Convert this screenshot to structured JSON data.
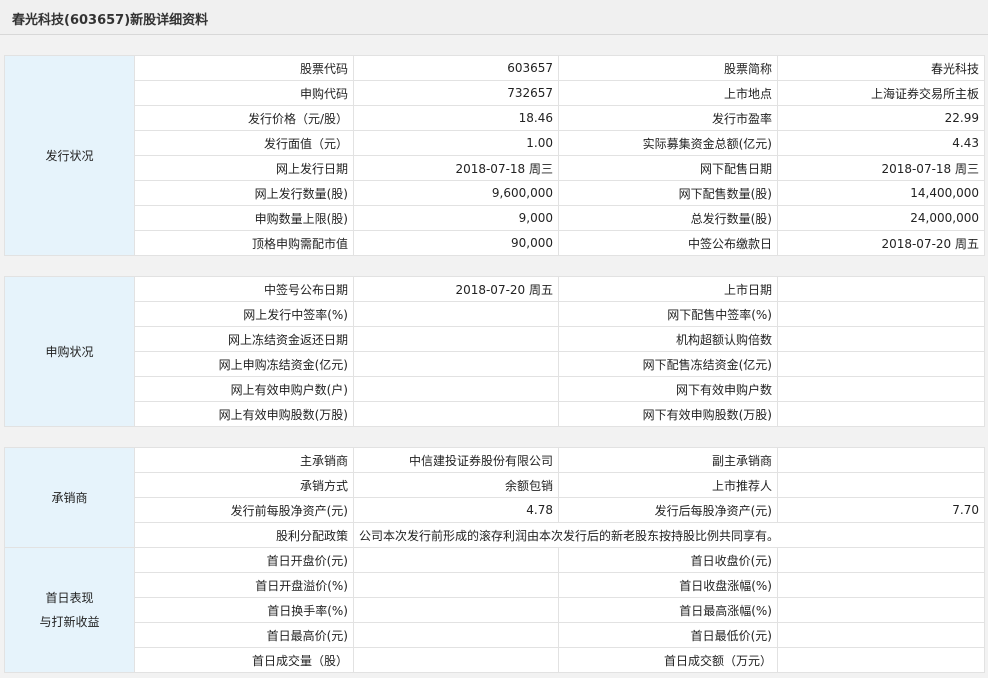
{
  "page_title": "春光科技(603657)新股详细资料",
  "sections": [
    {
      "group_lines": [
        "发行状况"
      ],
      "rows": [
        [
          "股票代码",
          "603657",
          "股票简称",
          "春光科技"
        ],
        [
          "申购代码",
          "732657",
          "上市地点",
          "上海证券交易所主板"
        ],
        [
          "发行价格（元/股）",
          "18.46",
          "发行市盈率",
          "22.99"
        ],
        [
          "发行面值（元）",
          "1.00",
          "实际募集资金总额(亿元)",
          "4.43"
        ],
        [
          "网上发行日期",
          "2018-07-18 周三",
          "网下配售日期",
          "2018-07-18 周三"
        ],
        [
          "网上发行数量(股)",
          "9,600,000",
          "网下配售数量(股)",
          "14,400,000"
        ],
        [
          "申购数量上限(股)",
          "9,000",
          "总发行数量(股)",
          "24,000,000"
        ],
        [
          "顶格申购需配市值",
          "90,000",
          "中签公布缴款日",
          "2018-07-20 周五"
        ]
      ]
    },
    {
      "group_lines": [
        "申购状况"
      ],
      "rows": [
        [
          "中签号公布日期",
          "2018-07-20 周五",
          "上市日期",
          ""
        ],
        [
          "网上发行中签率(%)",
          "",
          "网下配售中签率(%)",
          ""
        ],
        [
          "网上冻结资金返还日期",
          "",
          "机构超额认购倍数",
          ""
        ],
        [
          "网上申购冻结资金(亿元)",
          "",
          "网下配售冻结资金(亿元)",
          ""
        ],
        [
          "网上有效申购户数(户)",
          "",
          "网下有效申购户数",
          ""
        ],
        [
          "网上有效申购股数(万股)",
          "",
          "网下有效申购股数(万股)",
          ""
        ]
      ]
    },
    {
      "group_lines": [
        "承销商"
      ],
      "rows": [
        [
          "主承销商",
          "中信建投证券股份有限公司",
          "副主承销商",
          ""
        ],
        [
          "承销方式",
          "余额包销",
          "上市推荐人",
          ""
        ],
        [
          "发行前每股净资产(元)",
          "4.78",
          "发行后每股净资产(元)",
          "7.70"
        ]
      ],
      "policy": {
        "label": "股利分配政策",
        "text": "公司本次发行前形成的滚存利润由本次发行后的新老股东按持股比例共同享有。"
      }
    },
    {
      "group_lines": [
        "首日表现",
        "与打新收益"
      ],
      "rows": [
        [
          "首日开盘价(元)",
          "",
          "首日收盘价(元)",
          ""
        ],
        [
          "首日开盘溢价(%)",
          "",
          "首日收盘涨幅(%)",
          ""
        ],
        [
          "首日换手率(%)",
          "",
          "首日最高涨幅(%)",
          ""
        ],
        [
          "首日最高价(元)",
          "",
          "首日最低价(元)",
          ""
        ],
        [
          "首日成交量（股）",
          "",
          "首日成交额（万元）",
          ""
        ]
      ]
    }
  ],
  "colors": {
    "page_background": "#f2f2f2",
    "group_cell_background": "#e6f3fb",
    "cell_border": "#e2e2e2"
  }
}
